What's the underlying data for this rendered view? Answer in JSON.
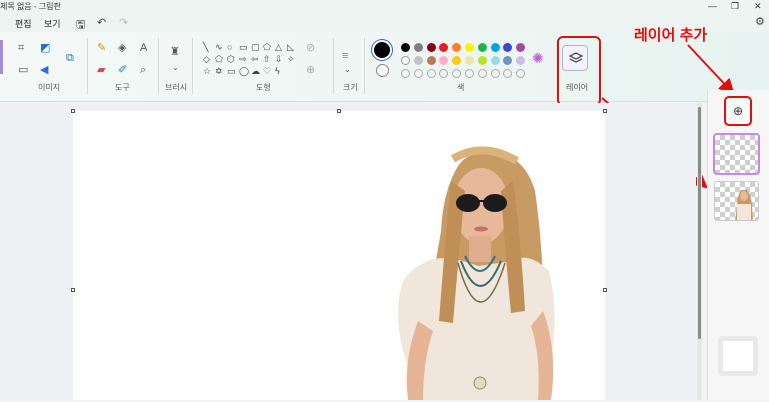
{
  "titlebar": {
    "title": "제목 없음 - 그림판"
  },
  "menu": {
    "edit": "편집",
    "view": "보기"
  },
  "ribbon": {
    "groups": {
      "image": "이미지",
      "tools": "도구",
      "brushes": "브러시",
      "shapes": "도형",
      "size": "크기",
      "colors": "색",
      "layers": "레이어"
    }
  },
  "palette": {
    "row1": [
      "#000000",
      "#7f7f7f",
      "#880015",
      "#ed1c24",
      "#ff7f27",
      "#fff200",
      "#22b14c",
      "#00a2e8",
      "#3f48cc",
      "#a349a4"
    ],
    "row2": [
      "#ffffff",
      "#c3c3c3",
      "#b97a57",
      "#ffaec9",
      "#ffc90e",
      "#efe4b0",
      "#b5e61d",
      "#99d9ea",
      "#7092be",
      "#c8bfe7"
    ]
  },
  "annotation": {
    "text": "레이어 추가"
  },
  "colors": {
    "annotation_red": "#e01010",
    "layer_selected": "#c48be6"
  },
  "icons": {
    "add_layer": "plus-circle-icon",
    "layers": "layers-icon",
    "settings": "gear-icon"
  }
}
